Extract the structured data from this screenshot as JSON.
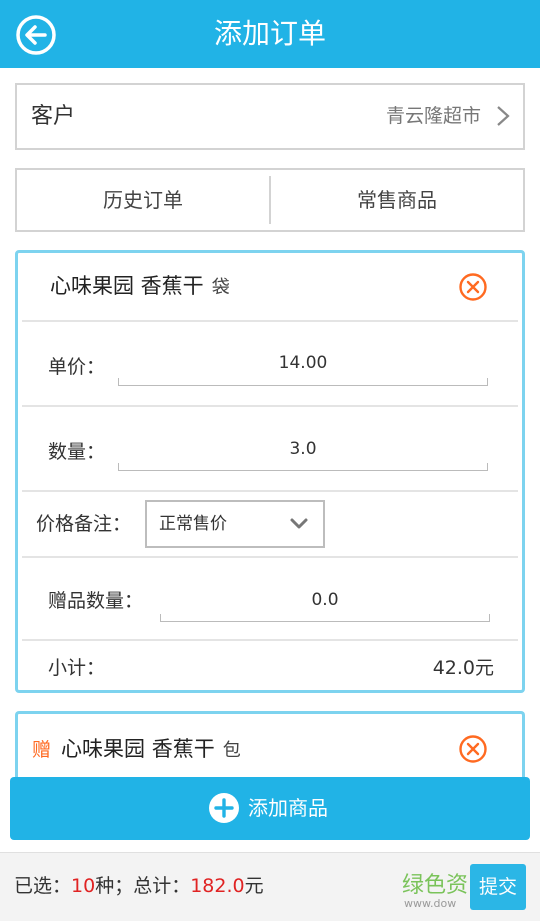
{
  "header": {
    "title": "添加订单"
  },
  "customer": {
    "label": "客户",
    "value": "青云隆超市"
  },
  "tabs": [
    {
      "label": "历史订单"
    },
    {
      "label": "常售商品"
    }
  ],
  "items": [
    {
      "name": "心味果园 香蕉干",
      "unit": "袋",
      "unit_price_label": "单价：",
      "unit_price": "14.00",
      "quantity_label": "数量：",
      "quantity": "3.0",
      "price_note_label": "价格备注：",
      "price_note": "正常售价",
      "gift_qty_label": "赠品数量：",
      "gift_qty": "0.0",
      "subtotal_label": "小计：",
      "subtotal": "42.0元"
    },
    {
      "gift_tag": "赠",
      "name": "心味果园 香蕉干",
      "unit": "包"
    }
  ],
  "add_button": {
    "label": "添加商品"
  },
  "summary": {
    "prefix": "已选：",
    "count": "10",
    "count_suffix": "种；总计：",
    "total": "182.0",
    "total_suffix": "元"
  },
  "watermark": {
    "text": "绿色资",
    "sub": "www.dow"
  },
  "submit": {
    "label": "提交"
  },
  "colors": {
    "accent": "#21b3e6",
    "card_border": "#7dd3ef",
    "remove": "#ff6a21",
    "price_red": "#e02323"
  }
}
